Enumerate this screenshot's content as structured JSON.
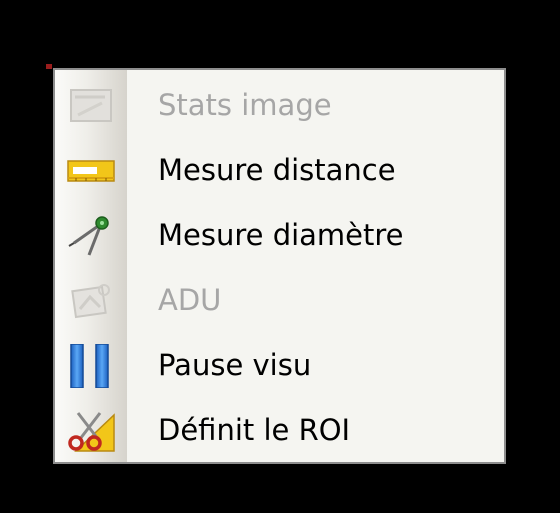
{
  "context_menu": {
    "items": [
      {
        "label": "Stats image",
        "icon": "stats-image-icon",
        "enabled": false
      },
      {
        "label": "Mesure distance",
        "icon": "ruler-icon",
        "enabled": true
      },
      {
        "label": "Mesure diamètre",
        "icon": "compass-icon",
        "enabled": true
      },
      {
        "label": "ADU",
        "icon": "adu-icon",
        "enabled": false
      },
      {
        "label": "Pause visu",
        "icon": "pause-icon",
        "enabled": true
      },
      {
        "label": "Définit le ROI",
        "icon": "scissors-roi-icon",
        "enabled": true
      }
    ],
    "colors": {
      "background": "#f5f5f1",
      "border": "#8d8d8d",
      "enabled_text": "#000000",
      "disabled_text": "#a6a6a6",
      "pause_blue": "#2f7fe0",
      "ruler_yellow": "#f2c619"
    }
  }
}
